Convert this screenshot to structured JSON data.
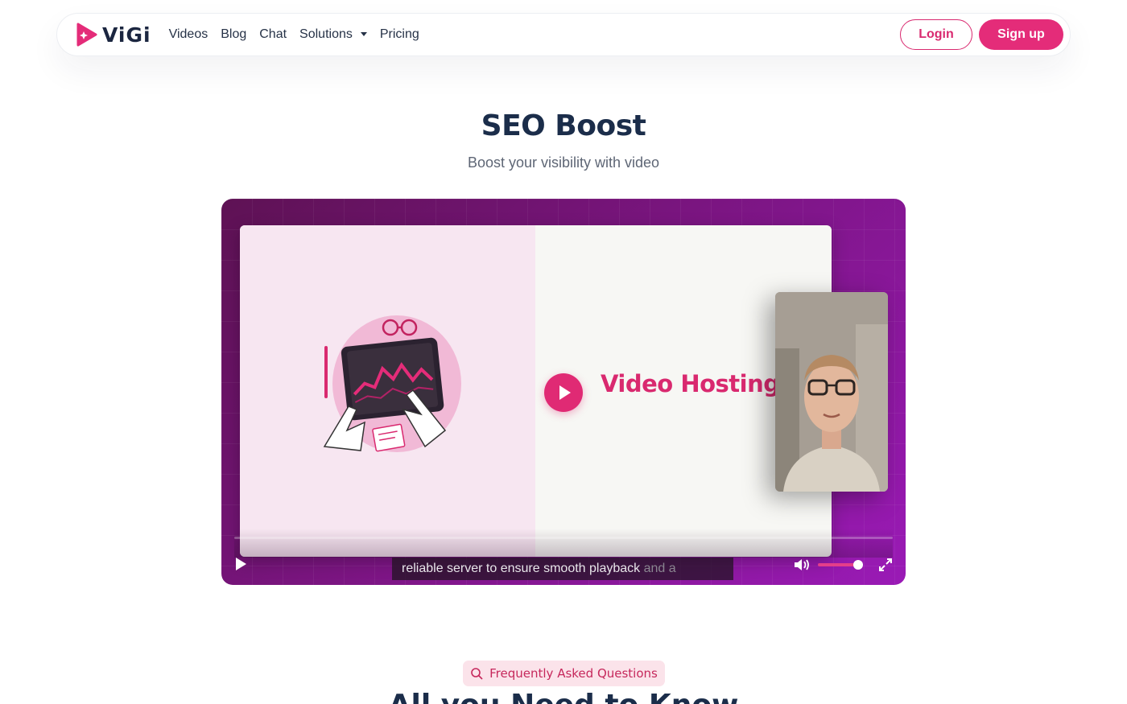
{
  "brand": {
    "name": "ViGi",
    "accent": "#e42c79"
  },
  "nav": {
    "links": [
      {
        "label": "Videos"
      },
      {
        "label": "Blog"
      },
      {
        "label": "Chat"
      },
      {
        "label": "Solutions",
        "dropdown": true
      },
      {
        "label": "Pricing"
      }
    ],
    "login_label": "Login",
    "signup_label": "Sign up"
  },
  "hero": {
    "title": "SEO Boost",
    "subtitle": "Boost your visibility with video"
  },
  "video": {
    "slide_heading": "Video Hosting",
    "caption_main": "reliable server to ensure smooth playback",
    "caption_fade": " and a",
    "volume_level": 0.9
  },
  "faq": {
    "badge": "Frequently Asked Questions",
    "heading": "All you Need to Know"
  }
}
